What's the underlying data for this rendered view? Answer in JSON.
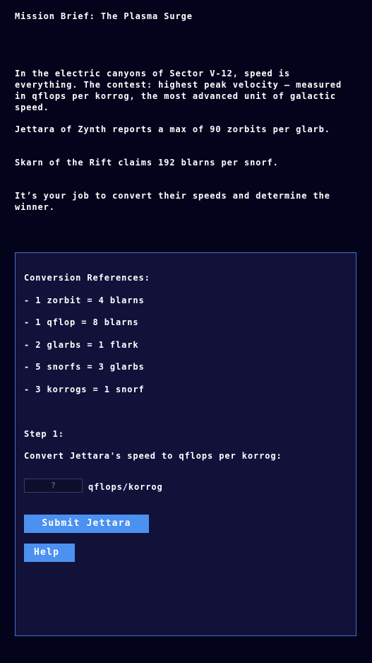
{
  "title": "Mission Brief: The Plasma Surge",
  "story": {
    "intro": "In the electric canyons of Sector V-12, speed is everything. The contest: highest peak velocity — measured in qflops per korrog, the most advanced unit of galactic speed.",
    "jettara": "Jettara of Zynth reports a max of 90 zorbits per glarb.",
    "skarn": "Skarn of the Rift claims 192 blarns per snorf.",
    "task": "It’s your job to convert their speeds and determine the winner."
  },
  "panel": {
    "references_heading": "Conversion References:",
    "references": [
      "- 1 zorbit = 4 blarns",
      "- 1 qflop = 8 blarns",
      "- 2 glarbs = 1 flark",
      "- 5 snorfs = 3 glarbs",
      "- 3 korrogs = 1 snorf"
    ],
    "step_label": "Step 1:",
    "step_instruction": "Convert Jettara's speed to qflops per korrog:",
    "answer_placeholder": "?",
    "answer_value": "",
    "unit_label": "qflops/korrog",
    "submit_label": "Submit Jettara",
    "help_label": "Help"
  },
  "colors": {
    "background": "#03031c",
    "panel_background": "#11113a",
    "panel_border": "#3f72c7",
    "button": "#4b91f0",
    "text": "#ffffff"
  }
}
